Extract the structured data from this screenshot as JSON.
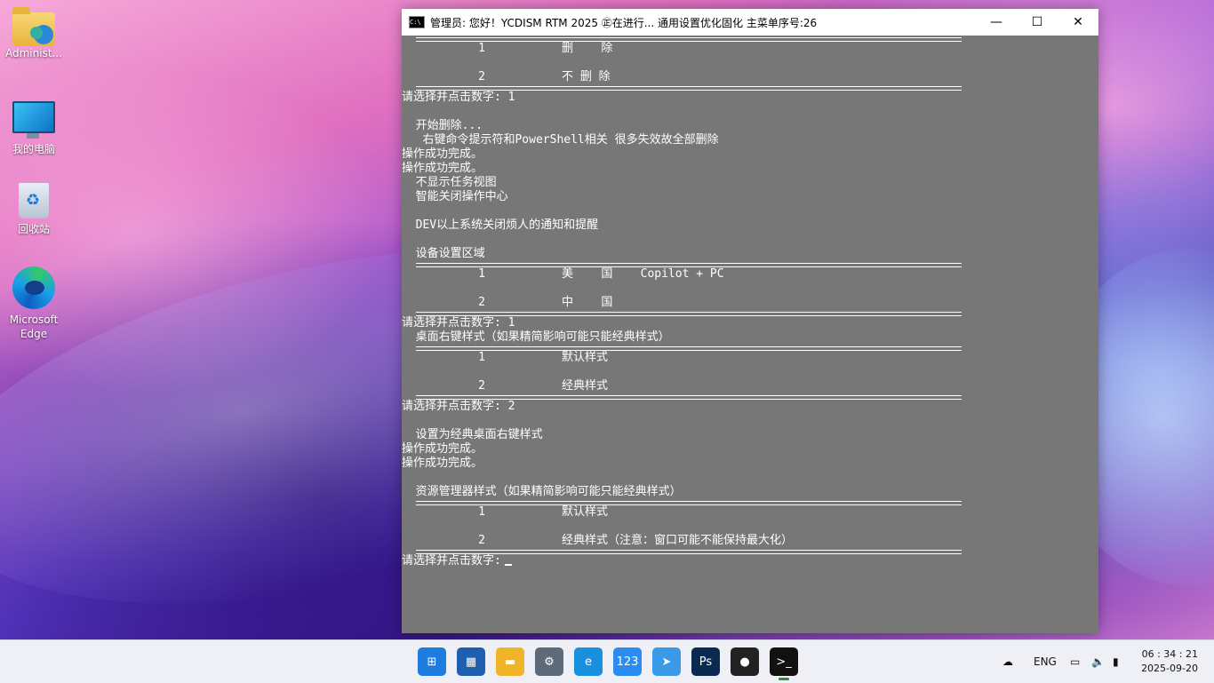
{
  "desktop": {
    "icons": [
      {
        "label": "Administ..."
      },
      {
        "label": "我的电脑"
      },
      {
        "label": "回收站"
      },
      {
        "label": "Microsoft Edge"
      }
    ]
  },
  "window": {
    "title": "管理员:   您好！YCDISM RTM 2025 ㊣在进行... 通用设置优化固化   主菜单序号:26",
    "lines": [
      {
        "type": "sep"
      },
      {
        "type": "text",
        "text": "           1           删    除"
      },
      {
        "type": "blank"
      },
      {
        "type": "text",
        "text": "           2           不 删 除"
      },
      {
        "type": "sep"
      },
      {
        "type": "text",
        "text": "请选择并点击数字: 1"
      },
      {
        "type": "blank"
      },
      {
        "type": "text",
        "text": "  开始删除..."
      },
      {
        "type": "text",
        "text": "   右键命令提示符和PowerShell相关 很多失效故全部删除"
      },
      {
        "type": "text",
        "text": "操作成功完成。"
      },
      {
        "type": "text",
        "text": "操作成功完成。"
      },
      {
        "type": "text",
        "text": "  不显示任务视图"
      },
      {
        "type": "text",
        "text": "  智能关闭操作中心"
      },
      {
        "type": "blank"
      },
      {
        "type": "text",
        "text": "  DEV以上系统关闭烦人的通知和提醒"
      },
      {
        "type": "blank"
      },
      {
        "type": "text",
        "text": "  设备设置区域"
      },
      {
        "type": "sep"
      },
      {
        "type": "text",
        "text": "           1           美    国    Copilot + PC"
      },
      {
        "type": "blank"
      },
      {
        "type": "text",
        "text": "           2           中    国"
      },
      {
        "type": "sep"
      },
      {
        "type": "text",
        "text": "请选择并点击数字: 1"
      },
      {
        "type": "text",
        "text": "  桌面右键样式（如果精简影响可能只能经典样式）"
      },
      {
        "type": "sep"
      },
      {
        "type": "text",
        "text": "           1           默认样式"
      },
      {
        "type": "blank"
      },
      {
        "type": "text",
        "text": "           2           经典样式"
      },
      {
        "type": "sep"
      },
      {
        "type": "text",
        "text": "请选择并点击数字: 2"
      },
      {
        "type": "blank"
      },
      {
        "type": "text",
        "text": "  设置为经典桌面右键样式"
      },
      {
        "type": "text",
        "text": "操作成功完成。"
      },
      {
        "type": "text",
        "text": "操作成功完成。"
      },
      {
        "type": "blank"
      },
      {
        "type": "text",
        "text": "  资源管理器样式（如果精简影响可能只能经典样式）"
      },
      {
        "type": "sep"
      },
      {
        "type": "text",
        "text": "           1           默认样式"
      },
      {
        "type": "blank"
      },
      {
        "type": "text",
        "text": "           2           经典样式（注意：窗口可能不能保持最大化）"
      },
      {
        "type": "sep"
      },
      {
        "type": "prompt",
        "text": "请选择并点击数字:"
      }
    ]
  },
  "taskbar": {
    "apps": [
      {
        "name": "start",
        "glyph": "⊞",
        "color": "#1e7be0",
        "icon": "windows-start-icon"
      },
      {
        "name": "store",
        "glyph": "▦",
        "color": "#1f5fb0",
        "icon": "store-icon"
      },
      {
        "name": "file-explorer",
        "glyph": "▬",
        "color": "#f0b429",
        "icon": "folder-icon"
      },
      {
        "name": "settings",
        "glyph": "⚙",
        "color": "#5d6a7a",
        "icon": "gear-icon"
      },
      {
        "name": "edge",
        "glyph": "e",
        "color": "#1a8fe0",
        "icon": "edge-icon"
      },
      {
        "name": "123pan",
        "glyph": "123",
        "color": "#2a8cf0",
        "icon": "pan-123-icon"
      },
      {
        "name": "feishu",
        "glyph": "➤",
        "color": "#3a9ae8",
        "icon": "paper-plane-icon"
      },
      {
        "name": "photoshop",
        "glyph": "Ps",
        "color": "#0a2a52",
        "icon": "photoshop-icon"
      },
      {
        "name": "qq",
        "glyph": "●",
        "color": "#222",
        "icon": "qq-penguin-icon"
      },
      {
        "name": "terminal",
        "glyph": ">_",
        "color": "#111",
        "icon": "terminal-icon"
      }
    ],
    "tray": {
      "lang": "ENG"
    },
    "clock": {
      "time": "06 : 34 : 21",
      "date": "2025-09-20"
    }
  }
}
